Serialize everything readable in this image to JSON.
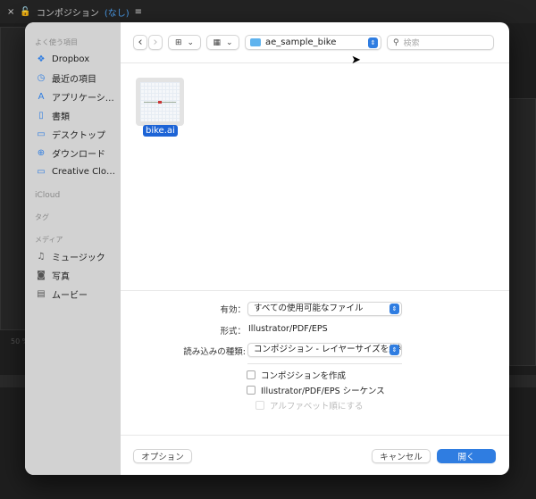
{
  "app": {
    "close": "×",
    "lock_icon": "unlock-icon",
    "title": "コンポジション",
    "title_suffix": "(なし)",
    "menu": "≡",
    "zoom_readout": "50 %"
  },
  "sidebar": {
    "favorites_header": "よく使う項目",
    "favorites": [
      {
        "label": "Dropbox",
        "icon": "dropbox-icon",
        "glyph": "❖"
      },
      {
        "label": "最近の項目",
        "icon": "clock-icon",
        "glyph": "◷"
      },
      {
        "label": "アプリケーシ…",
        "icon": "applications-icon",
        "glyph": "A"
      },
      {
        "label": "書類",
        "icon": "document-icon",
        "glyph": "▯"
      },
      {
        "label": "デスクトップ",
        "icon": "desktop-icon",
        "glyph": "▭"
      },
      {
        "label": "ダウンロード",
        "icon": "download-icon",
        "glyph": "⊕"
      },
      {
        "label": "Creative Clo…",
        "icon": "folder-icon",
        "glyph": "▭"
      }
    ],
    "icloud_header": "iCloud",
    "tags_header": "タグ",
    "media_header": "メディア",
    "media": [
      {
        "label": "ミュージック",
        "icon": "music-icon",
        "glyph": "♫"
      },
      {
        "label": "写真",
        "icon": "camera-icon",
        "glyph": "◙"
      },
      {
        "label": "ムービー",
        "icon": "film-icon",
        "glyph": "▤"
      }
    ]
  },
  "toolbar": {
    "back": "‹",
    "forward": "›",
    "view_icon": "⊞",
    "group_icon": "▦",
    "chevron": "⌄",
    "path": "ae_sample_bike",
    "stepper": "⇕",
    "search_placeholder": "検索",
    "search_icon": "⚲"
  },
  "files": [
    {
      "name": "bike.ai",
      "selected": true
    }
  ],
  "options": {
    "enable_label": "有効：",
    "enable_value": "すべての使用可能なファイル",
    "format_label": "形式：",
    "format_value": "Illustrator/PDF/EPS",
    "import_label": "読み込みの種類:",
    "import_value": "コンポジション - レイヤーサイズを維持",
    "checkboxes": [
      {
        "label": "コンポジションを作成",
        "checked": false,
        "enabled": true
      },
      {
        "label": "Illustrator/PDF/EPS シーケンス",
        "checked": false,
        "enabled": true
      },
      {
        "label": "アルファベット順にする",
        "checked": false,
        "enabled": false
      }
    ]
  },
  "footer": {
    "options": "オプション",
    "cancel": "キャンセル",
    "open": "開く"
  },
  "colors": {
    "accent": "#2f7de1",
    "selection": "#1d64d6"
  }
}
